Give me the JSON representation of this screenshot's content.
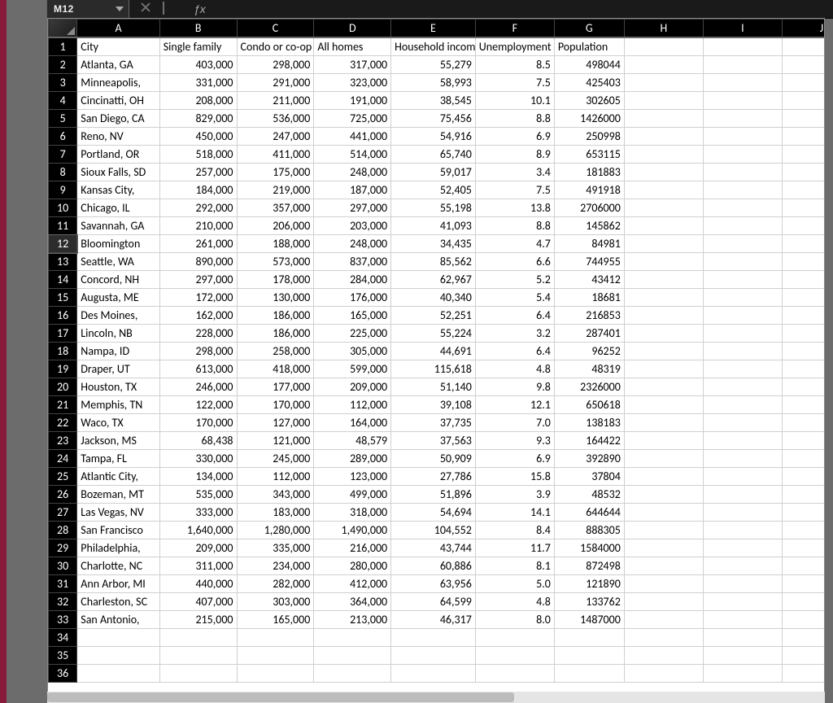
{
  "name_box": "M12",
  "formula_value": "",
  "icons": {
    "cancel": "cancel-icon",
    "enter": "enter-icon",
    "fx": "fx-icon"
  },
  "selected_row": 12,
  "columns": [
    "A",
    "B",
    "C",
    "D",
    "E",
    "F",
    "G",
    "H",
    "I",
    "J"
  ],
  "blank_rows": [
    34,
    35,
    36
  ],
  "headers": {
    "A": "City",
    "B": "Single family",
    "C": "Condo or co-op",
    "D": "All homes",
    "E": "Household income",
    "F": "Unemployment",
    "G": "Population",
    "H": "",
    "I": "",
    "J": ""
  },
  "rows": [
    {
      "r": 2,
      "A": "Atlanta, GA",
      "B": "403,000",
      "C": "298,000",
      "D": "317,000",
      "E": "55,279",
      "F": "8.5",
      "G": "498044"
    },
    {
      "r": 3,
      "A": "Minneapolis,",
      "B": "331,000",
      "C": "291,000",
      "D": "323,000",
      "E": "58,993",
      "F": "7.5",
      "G": "425403"
    },
    {
      "r": 4,
      "A": "Cincinatti, OH",
      "B": "208,000",
      "C": "211,000",
      "D": "191,000",
      "E": "38,545",
      "F": "10.1",
      "G": "302605"
    },
    {
      "r": 5,
      "A": "San Diego, CA",
      "B": "829,000",
      "C": "536,000",
      "D": "725,000",
      "E": "75,456",
      "F": "8.8",
      "G": "1426000"
    },
    {
      "r": 6,
      "A": "Reno, NV",
      "B": "450,000",
      "C": "247,000",
      "D": "441,000",
      "E": "54,916",
      "F": "6.9",
      "G": "250998"
    },
    {
      "r": 7,
      "A": "Portland, OR",
      "B": "518,000",
      "C": "411,000",
      "D": "514,000",
      "E": "65,740",
      "F": "8.9",
      "G": "653115"
    },
    {
      "r": 8,
      "A": "Sioux Falls, SD",
      "B": "257,000",
      "C": "175,000",
      "D": "248,000",
      "E": "59,017",
      "F": "3.4",
      "G": "181883"
    },
    {
      "r": 9,
      "A": "Kansas City,",
      "B": "184,000",
      "C": "219,000",
      "D": "187,000",
      "E": "52,405",
      "F": "7.5",
      "G": "491918"
    },
    {
      "r": 10,
      "A": "Chicago, IL",
      "B": "292,000",
      "C": "357,000",
      "D": "297,000",
      "E": "55,198",
      "F": "13.8",
      "G": "2706000"
    },
    {
      "r": 11,
      "A": "Savannah, GA",
      "B": "210,000",
      "C": "206,000",
      "D": "203,000",
      "E": "41,093",
      "F": "8.8",
      "G": "145862"
    },
    {
      "r": 12,
      "A": "Bloomington",
      "B": "261,000",
      "C": "188,000",
      "D": "248,000",
      "E": "34,435",
      "F": "4.7",
      "G": "84981"
    },
    {
      "r": 13,
      "A": "Seattle, WA",
      "B": "890,000",
      "C": "573,000",
      "D": "837,000",
      "E": "85,562",
      "F": "6.6",
      "G": "744955"
    },
    {
      "r": 14,
      "A": "Concord, NH",
      "B": "297,000",
      "C": "178,000",
      "D": "284,000",
      "E": "62,967",
      "F": "5.2",
      "G": "43412"
    },
    {
      "r": 15,
      "A": "Augusta, ME",
      "B": "172,000",
      "C": "130,000",
      "D": "176,000",
      "E": "40,340",
      "F": "5.4",
      "G": "18681"
    },
    {
      "r": 16,
      "A": "Des Moines,",
      "B": "162,000",
      "C": "186,000",
      "D": "165,000",
      "E": "52,251",
      "F": "6.4",
      "G": "216853"
    },
    {
      "r": 17,
      "A": "Lincoln, NB",
      "B": "228,000",
      "C": "186,000",
      "D": "225,000",
      "E": "55,224",
      "F": "3.2",
      "G": "287401"
    },
    {
      "r": 18,
      "A": "Nampa, ID",
      "B": "298,000",
      "C": "258,000",
      "D": "305,000",
      "E": "44,691",
      "F": "6.4",
      "G": "96252"
    },
    {
      "r": 19,
      "A": "Draper, UT",
      "B": "613,000",
      "C": "418,000",
      "D": "599,000",
      "E": "115,618",
      "F": "4.8",
      "G": "48319"
    },
    {
      "r": 20,
      "A": "Houston, TX",
      "B": "246,000",
      "C": "177,000",
      "D": "209,000",
      "E": "51,140",
      "F": "9.8",
      "G": "2326000"
    },
    {
      "r": 21,
      "A": "Memphis, TN",
      "B": "122,000",
      "C": "170,000",
      "D": "112,000",
      "E": "39,108",
      "F": "12.1",
      "G": "650618"
    },
    {
      "r": 22,
      "A": "Waco, TX",
      "B": "170,000",
      "C": "127,000",
      "D": "164,000",
      "E": "37,735",
      "F": "7.0",
      "G": "138183"
    },
    {
      "r": 23,
      "A": "Jackson, MS",
      "B": "68,438",
      "C": "121,000",
      "D": "48,579",
      "E": "37,563",
      "F": "9.3",
      "G": "164422"
    },
    {
      "r": 24,
      "A": "Tampa, FL",
      "B": "330,000",
      "C": "245,000",
      "D": "289,000",
      "E": "50,909",
      "F": "6.9",
      "G": "392890"
    },
    {
      "r": 25,
      "A": "Atlantic City,",
      "B": "134,000",
      "C": "112,000",
      "D": "123,000",
      "E": "27,786",
      "F": "15.8",
      "G": "37804"
    },
    {
      "r": 26,
      "A": "Bozeman, MT",
      "B": "535,000",
      "C": "343,000",
      "D": "499,000",
      "E": "51,896",
      "F": "3.9",
      "G": "48532"
    },
    {
      "r": 27,
      "A": "Las Vegas, NV",
      "B": "333,000",
      "C": "183,000",
      "D": "318,000",
      "E": "54,694",
      "F": "14.1",
      "G": "644644"
    },
    {
      "r": 28,
      "A": "San Francisco",
      "B": "1,640,000",
      "C": "1,280,000",
      "D": "1,490,000",
      "E": "104,552",
      "F": "8.4",
      "G": "888305"
    },
    {
      "r": 29,
      "A": "Philadelphia,",
      "B": "209,000",
      "C": "335,000",
      "D": "216,000",
      "E": "43,744",
      "F": "11.7",
      "G": "1584000"
    },
    {
      "r": 30,
      "A": "Charlotte, NC",
      "B": "311,000",
      "C": "234,000",
      "D": "280,000",
      "E": "60,886",
      "F": "8.1",
      "G": "872498"
    },
    {
      "r": 31,
      "A": "Ann Arbor, MI",
      "B": "440,000",
      "C": "282,000",
      "D": "412,000",
      "E": "63,956",
      "F": "5.0",
      "G": "121890"
    },
    {
      "r": 32,
      "A": "Charleston, SC",
      "B": "407,000",
      "C": "303,000",
      "D": "364,000",
      "E": "64,599",
      "F": "4.8",
      "G": "133762"
    },
    {
      "r": 33,
      "A": "San Antonio,",
      "B": "215,000",
      "C": "165,000",
      "D": "213,000",
      "E": "46,317",
      "F": "8.0",
      "G": "1487000"
    }
  ]
}
